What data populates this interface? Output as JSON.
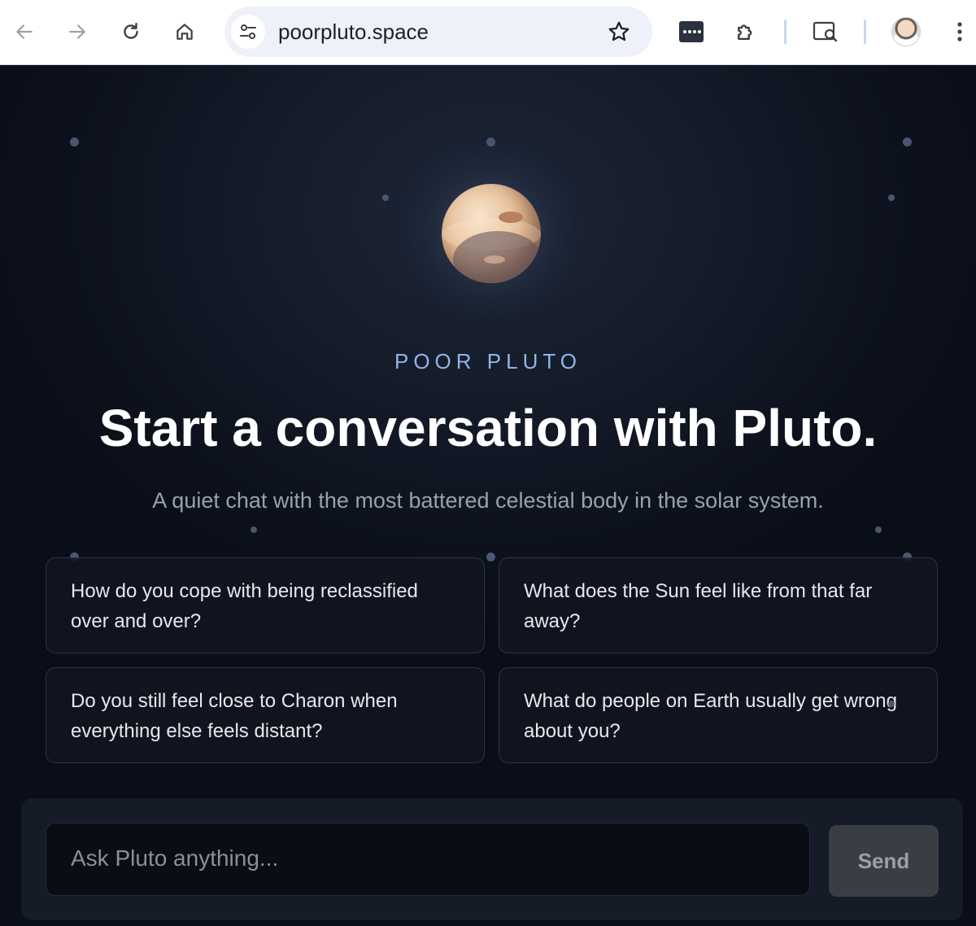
{
  "browser": {
    "url": "poorpluto.space"
  },
  "hero": {
    "eyebrow": "POOR PLUTO",
    "headline": "Start a conversation with Pluto.",
    "subtitle": "A quiet chat with the most battered celestial body in the solar system."
  },
  "suggestions": [
    {
      "text": "How do you cope with being reclassified over and over?"
    },
    {
      "text": "What does the Sun feel like from that far away?"
    },
    {
      "text": "Do you still feel close to Charon when everything else feels distant?"
    },
    {
      "text": "What do people on Earth usually get wrong about you?"
    }
  ],
  "composer": {
    "placeholder": "Ask Pluto anything...",
    "send_label": "Send"
  },
  "colors": {
    "accent": "#8fb6e8",
    "background": "#0b0f1a"
  }
}
